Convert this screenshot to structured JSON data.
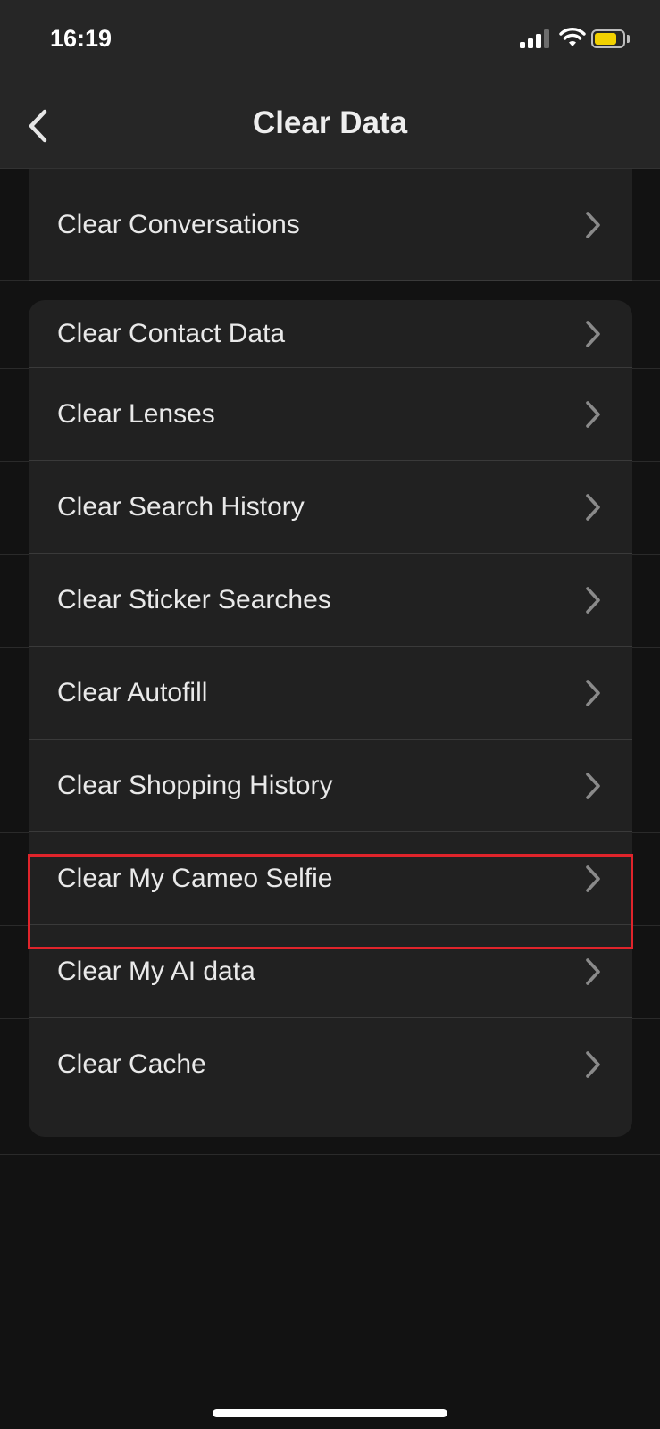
{
  "status_bar": {
    "time": "16:19",
    "signal_icon": "cellular-signal-icon",
    "wifi_icon": "wifi-icon",
    "battery_icon": "battery-icon",
    "battery_level": 0.8,
    "battery_color": "#f2d100"
  },
  "nav": {
    "back_icon": "chevron-left-icon",
    "title": "Clear Data"
  },
  "sections": [
    {
      "items": [
        {
          "label": "Clear Conversations",
          "icon": "chevron-right-icon"
        }
      ]
    },
    {
      "items": [
        {
          "label": "Clear Contact Data",
          "icon": "chevron-right-icon"
        },
        {
          "label": "Clear Lenses",
          "icon": "chevron-right-icon"
        },
        {
          "label": "Clear Search History",
          "icon": "chevron-right-icon"
        },
        {
          "label": "Clear Sticker Searches",
          "icon": "chevron-right-icon"
        },
        {
          "label": "Clear Autofill",
          "icon": "chevron-right-icon"
        },
        {
          "label": "Clear Shopping History",
          "icon": "chevron-right-icon"
        },
        {
          "label": "Clear My Cameo Selfie",
          "icon": "chevron-right-icon",
          "highlighted": true
        },
        {
          "label": "Clear My AI data",
          "icon": "chevron-right-icon"
        },
        {
          "label": "Clear Cache",
          "icon": "chevron-right-icon"
        }
      ]
    }
  ],
  "colors": {
    "background": "#121212",
    "card": "#212121",
    "highlight": "#e0242b"
  }
}
